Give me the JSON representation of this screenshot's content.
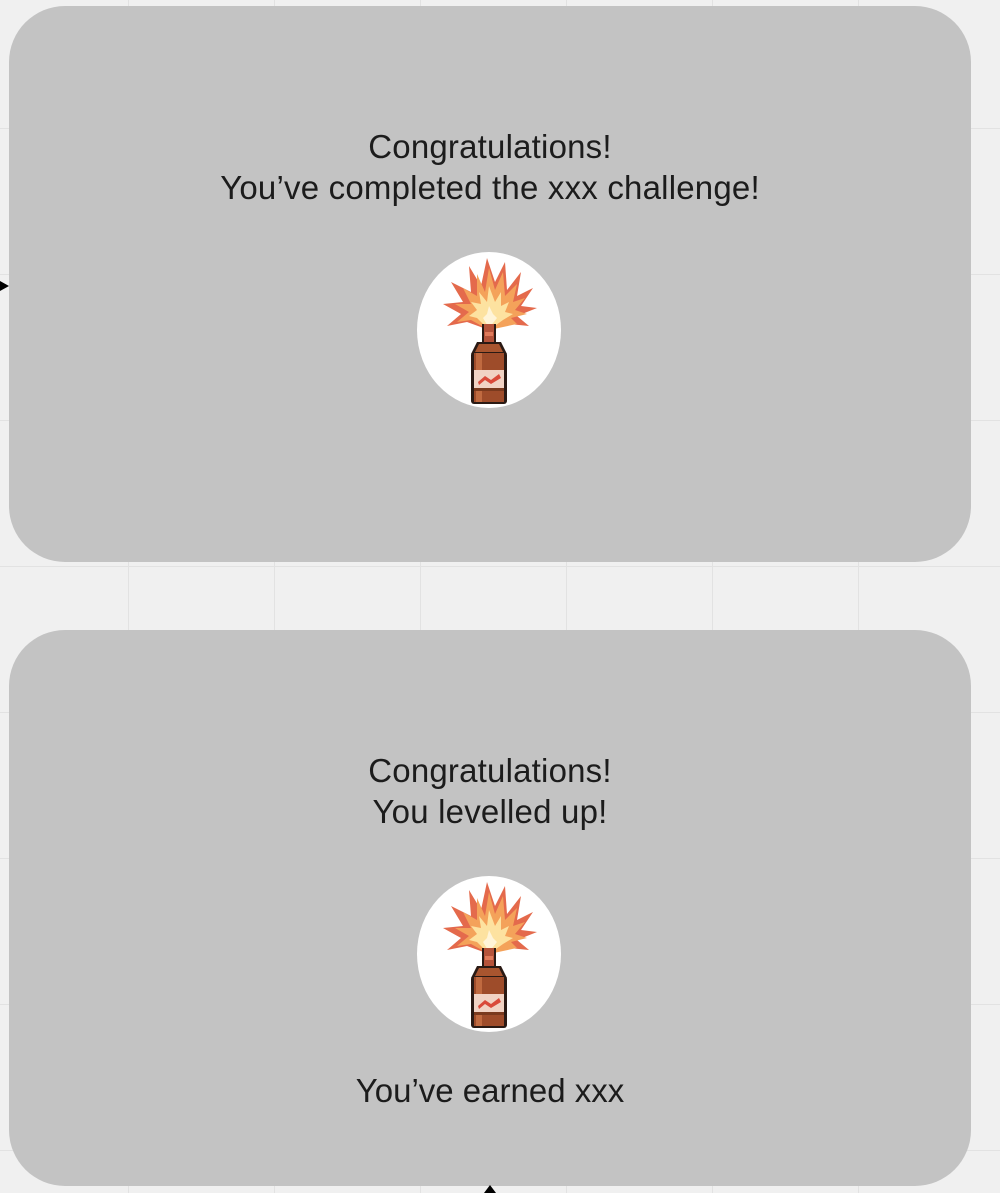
{
  "cards": [
    {
      "line1": "Congratulations!",
      "line2": "You’ve completed the xxx challenge!",
      "badge_icon": "flaming-bottle-icon"
    },
    {
      "line1": "Congratulations!",
      "line2": "You levelled up!",
      "badge_icon": "flaming-bottle-icon",
      "reward": "You’ve earned xxx"
    }
  ],
  "colors": {
    "canvas": "#f0f0f0",
    "card": "#c3c3c3",
    "badge_bg": "#ffffff",
    "text": "#1c1c1c"
  }
}
